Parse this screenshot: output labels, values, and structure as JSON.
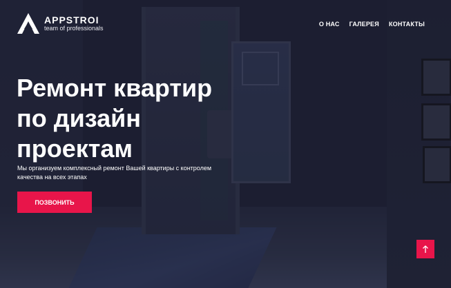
{
  "header": {
    "brand": "APPSTROI",
    "tagline": "team of professionals",
    "nav": [
      "О НАС",
      "ГАЛЕРЕЯ",
      "КОНТАКТЫ"
    ]
  },
  "hero": {
    "title_lines": [
      "Ремонт квартир",
      "по дизайн",
      "проектам"
    ],
    "description": "Мы организуем комплексный ремонт Вашей квартиры с контролем качества на всех этапах",
    "cta_label": "ПОЗВОНИТЬ"
  },
  "icons": {
    "logo": "triangle-logo-icon",
    "scroll_top": "arrow-up-icon"
  },
  "colors": {
    "accent": "#e8154a",
    "text": "#ffffff"
  }
}
